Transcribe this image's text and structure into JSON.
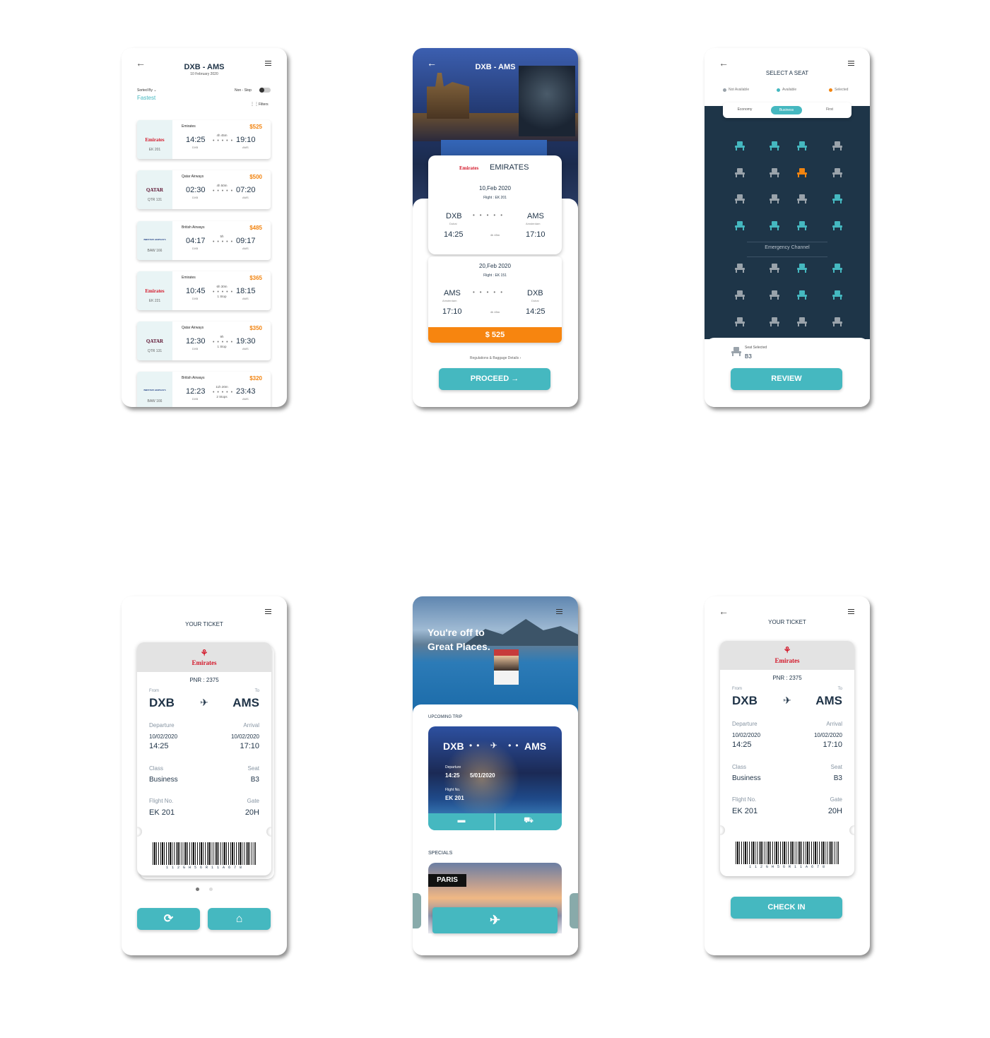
{
  "screen1": {
    "title": "DXB - AMS",
    "date": "10 February 2020",
    "sorted_by_label": "Sorted By ⌄",
    "sorted_by_value": "Fastest",
    "nonstop_label": "Non - Stop",
    "filters_label": "Filters",
    "flights": [
      {
        "airline": "Emirates",
        "logo": "Emirates",
        "code": "EK 201",
        "price": "$525",
        "dep": "14:25",
        "arr": "19:10",
        "from": "DXB",
        "to": "AMS",
        "duration": "4h 45m",
        "stops": ""
      },
      {
        "airline": "Qatar Airways",
        "logo": "QATAR",
        "code": "QTR 131",
        "price": "$500",
        "dep": "02:30",
        "arr": "07:20",
        "from": "DXB",
        "to": "AMS",
        "duration": "4h 50m",
        "stops": ""
      },
      {
        "airline": "British Airways",
        "logo": "BRITISH AIRWAYS",
        "code": "BAW 166",
        "price": "$485",
        "dep": "04:17",
        "arr": "09:17",
        "from": "DXB",
        "to": "AMS",
        "duration": "5h",
        "stops": ""
      },
      {
        "airline": "Emirates",
        "logo": "Emirates",
        "code": "EK 221",
        "price": "$365",
        "dep": "10:45",
        "arr": "18:15",
        "from": "DXB",
        "to": "AMS",
        "duration": "6h 30m",
        "stops": "1 Stop"
      },
      {
        "airline": "Qatar Airways",
        "logo": "QATAR",
        "code": "QTR 131",
        "price": "$350",
        "dep": "12:30",
        "arr": "19:30",
        "from": "DXB",
        "to": "AMS",
        "duration": "9h",
        "stops": "1 Stop"
      },
      {
        "airline": "British Airways",
        "logo": "BRITISH AIRWAYS",
        "code": "BAW 166",
        "price": "$320",
        "dep": "12:23",
        "arr": "23:43",
        "from": "DXB",
        "to": "AMS",
        "duration": "11h 20m",
        "stops": "2 Stops"
      }
    ]
  },
  "screen2": {
    "title": "DXB - AMS",
    "airline": "EMIRATES",
    "airline_logo": "Emirates",
    "out": {
      "date": "10,Feb 2020",
      "flight": "Flight : EK 201",
      "from": "DXB",
      "from_city": "Dubai",
      "to": "AMS",
      "to_city": "Amsterdam",
      "dep": "14:25",
      "arr": "17:10",
      "duration": "4h 45m"
    },
    "ret": {
      "date": "20,Feb 2020",
      "flight": "Flight : EK 151",
      "from": "AMS",
      "from_city": "Amsterdam",
      "to": "DXB",
      "to_city": "Dubai",
      "dep": "17:10",
      "arr": "14:25",
      "duration": "4h 45m"
    },
    "price": "$ 525",
    "regulations": "Regulations & Baggage Details",
    "proceed": "PROCEED"
  },
  "screen3": {
    "title": "SELECT A SEAT",
    "legend": [
      "Not Available",
      "Available",
      "Selected"
    ],
    "tabs": [
      "Economy",
      "Business",
      "First"
    ],
    "active_tab": "Business",
    "emergency": "Emergency Channel",
    "seat_rows": [
      [
        "available",
        "available",
        "available",
        "unavailable"
      ],
      [
        "unavailable",
        "unavailable",
        "selected",
        "unavailable"
      ],
      [
        "unavailable",
        "unavailable",
        "unavailable",
        "available"
      ],
      [
        "available",
        "available",
        "available",
        "available"
      ],
      [
        "unavailable",
        "unavailable",
        "available",
        "available"
      ],
      [
        "unavailable",
        "unavailable",
        "available",
        "available"
      ],
      [
        "unavailable",
        "unavailable",
        "unavailable",
        "unavailable"
      ]
    ],
    "seat_selected_label": "Seat Selected",
    "seat_selected": "B3",
    "review": "REVIEW",
    "colors": {
      "available": "#45b8c0",
      "unavailable": "#9aa3ab",
      "selected": "#f28410",
      "panel": "#1e3548"
    }
  },
  "ticket": {
    "title": "YOUR TICKET",
    "logo": "Emirates",
    "pnr": "PNR : 2375",
    "from_label": "From",
    "to_label": "To",
    "from": "DXB",
    "to": "AMS",
    "departure_label": "Departure",
    "arrival_label": "Arrival",
    "dep_date": "10/02/2020",
    "dep_time": "14:25",
    "arr_date": "10/02/2020",
    "arr_time": "17:10",
    "class_label": "Class",
    "class": "Business",
    "seat_label": "Seat",
    "seat": "B3",
    "flight_label": "Flight No.",
    "flight": "EK 201",
    "gate_label": "Gate",
    "gate": "20H",
    "barcode_text": "1 1 2 G H 5 6 R 1 1 A 6 7 8",
    "check_in": "CHECK IN"
  },
  "screen5": {
    "hero_line1": "You're off to",
    "hero_line2": "Great Places.",
    "upcoming_label": "UPCOMING TRIP",
    "trip_from": "DXB",
    "trip_to": "AMS",
    "departure_label": "Departure",
    "dep_time": "14:25",
    "dep_date": "5/01/2020",
    "flight_label": "Flight No.",
    "flight": "EK 201",
    "specials_label": "SPECIALS",
    "special_city": "PARIS"
  }
}
